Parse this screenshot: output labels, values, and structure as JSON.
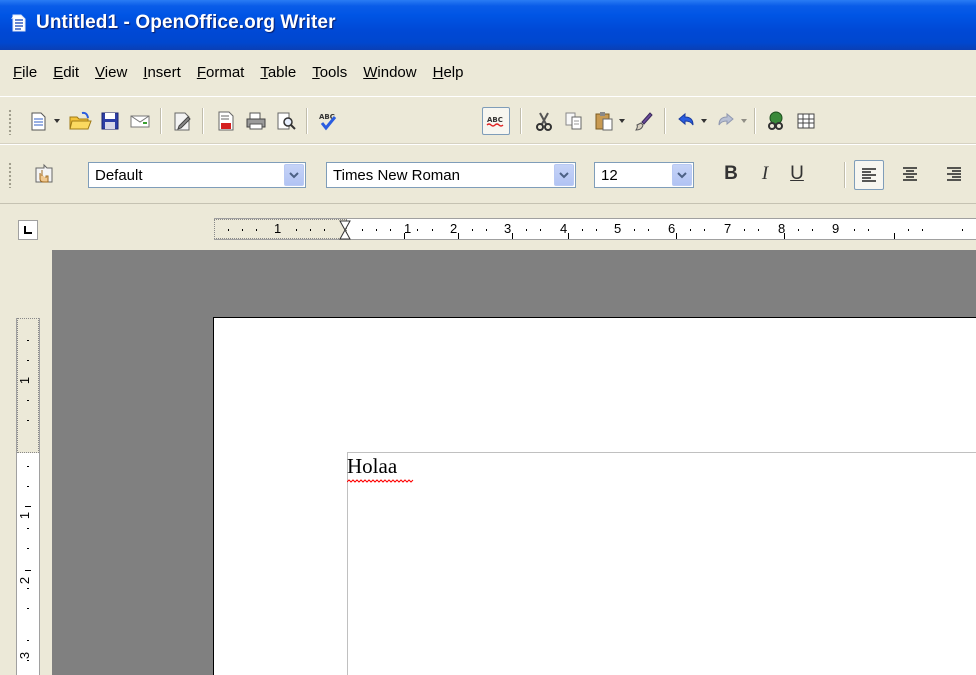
{
  "window": {
    "title": "Untitled1 - OpenOffice.org Writer"
  },
  "menubar": {
    "items": [
      "File",
      "Edit",
      "View",
      "Insert",
      "Format",
      "Table",
      "Tools",
      "Window",
      "Help"
    ]
  },
  "format_toolbar": {
    "paragraph_style": "Default",
    "font_name": "Times New Roman",
    "font_size": "12",
    "bold_label": "B",
    "italic_label": "I",
    "underline_label": "U"
  },
  "rulers": {
    "horizontal_labels": [
      "1",
      "1",
      "2",
      "3",
      "4",
      "5",
      "6",
      "7",
      "8",
      "9"
    ],
    "vertical_labels": [
      "1",
      "1",
      "2",
      "3"
    ]
  },
  "document": {
    "text": "Holaa"
  },
  "colors": {
    "title_bar": "#0055e5",
    "chrome": "#ece9d8",
    "workspace": "#808080",
    "spell_error": "#ff0000"
  }
}
